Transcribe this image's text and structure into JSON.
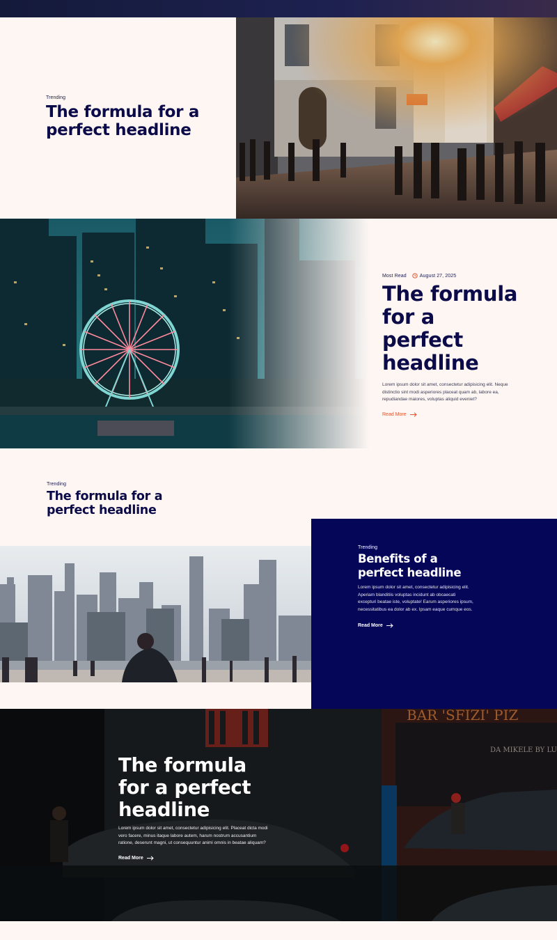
{
  "colors": {
    "background": "#fdf6f3",
    "navy": "#0c0b4a",
    "accent": "#e0522a",
    "deep_blue": "#050657"
  },
  "section1": {
    "eyebrow": "Trending",
    "headline": "The formula for a perfect headline"
  },
  "section2": {
    "eyebrow": "Most Read",
    "date": "August 27, 2025",
    "headline": "The formula for a perfect headline",
    "body": "Lorem ipsum dolor sit amet, consectetur adipisicing elit. Neque distinctio sint modi asperiores placeat quam ab, labore ea, repudiandae maiores, voluptas aliquid eveniet?",
    "read_more": "Read More",
    "icons": {
      "date": "clock-icon",
      "read_more": "arrow-right-icon"
    }
  },
  "section3": {
    "eyebrow": "Trending",
    "headline": "The formula for a perfect headline"
  },
  "section3_card": {
    "eyebrow": "Trending",
    "headline": "Benefits of a perfect headline",
    "body": "Lorem ipsum dolor sit amet, consectetur adipisicing elit. Aperiam blanditiis voluptas incidunt ab obcaecati excepturi beatae iste, voluptate! Earum asperiores ipsum, necessitatibus ea dolor ab ex. Ipsam eaque cumque eos.",
    "read_more": "Read More"
  },
  "section4": {
    "headline": "The formula for a perfect headline",
    "body": "Lorem ipsum dolor sit amet, consectetur adipisicing elit. Placeat dicta modi vero facere, minus itaque labore autem, harum nostrum accusantium ratione, deserunt magni, ut consequuntur animi omnis in beatae aliquam?",
    "read_more": "Read More",
    "sign_text": "BAR 'SFIZI' PIZ",
    "sign_subtext": "DA MIKELE BY LUZZ"
  }
}
